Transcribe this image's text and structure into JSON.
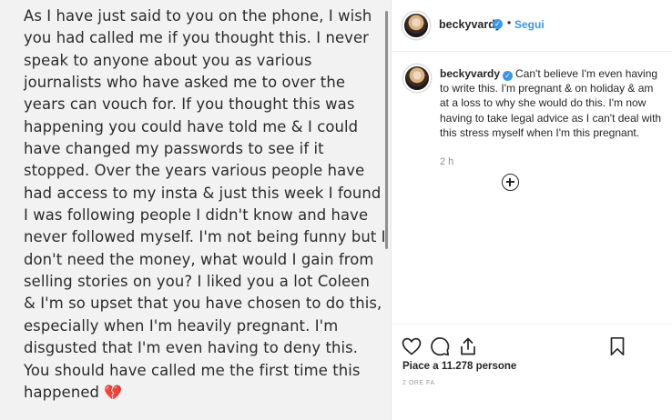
{
  "story": {
    "lines": [
      "As I have just said to you on the phone, I wish",
      "you had called me if you thought this. I never",
      "speak to anyone about you as various",
      "journalists who have asked me to over the",
      "years can vouch for. If you thought this was",
      "happening you could have told me & I could",
      "have changed my passwords to see if it",
      "stopped. Over the years various people have",
      "had access to my insta & just this week I found",
      "I was following people I didn't know and have",
      "never followed myself. I'm not being funny but I",
      "don't need the money, what would I gain from",
      "selling stories on you? I liked you a lot Coleen",
      "& I'm so upset that you have chosen to do this,",
      "especially when I'm heavily pregnant. I'm",
      "disgusted that I'm even having to deny this.",
      "You should have called me the first time this",
      "happened"
    ],
    "emoji": "💔"
  },
  "header": {
    "username": "beckyvardy",
    "verified": "✓",
    "separator": "•",
    "follow_label": "Segui"
  },
  "caption": {
    "username": "beckyvardy",
    "verified": "✓",
    "text": "Can't believe I'm even having to write this. I'm pregnant & on holiday & am at a loss to why she would do this. I'm now having to take legal advice as I can't deal with this stress myself when I'm this pregnant.",
    "timestamp": "2 h"
  },
  "actions": {
    "likes": "Piace a 11.278 persone",
    "posted_ago": "2 ORE FA"
  },
  "icons": {
    "like": "heart-icon",
    "comment": "comment-icon",
    "share": "share-icon",
    "save": "bookmark-icon",
    "load_more": "plus-circle-icon"
  }
}
